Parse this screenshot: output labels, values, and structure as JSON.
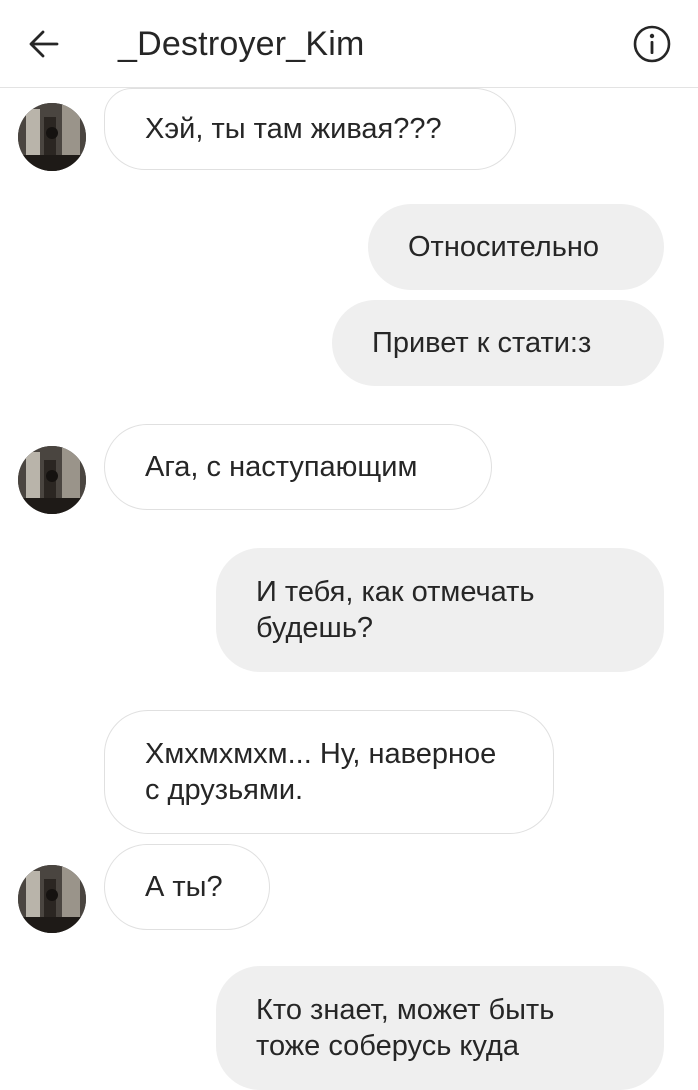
{
  "header": {
    "title": "_Destroyer_Kim",
    "back_icon": "arrow-left-icon",
    "info_icon": "info-circle-icon"
  },
  "messages": [
    {
      "direction": "incoming",
      "text": "Хэй, ты там живая???",
      "avatar": true
    },
    {
      "direction": "outgoing",
      "text": "Относительно"
    },
    {
      "direction": "outgoing",
      "text": "Привет к стати:з"
    },
    {
      "direction": "incoming",
      "text": "Ага, с наступающим",
      "avatar": true
    },
    {
      "direction": "outgoing",
      "text": "И тебя, как отмечать будешь?"
    },
    {
      "direction": "incoming",
      "text": "Хмхмхмхм... Ну, наверное с друзьями.",
      "avatar": false
    },
    {
      "direction": "incoming",
      "text": "А ты?",
      "avatar": true
    },
    {
      "direction": "outgoing",
      "text": "Кто знает, может быть тоже соберусь куда"
    }
  ]
}
